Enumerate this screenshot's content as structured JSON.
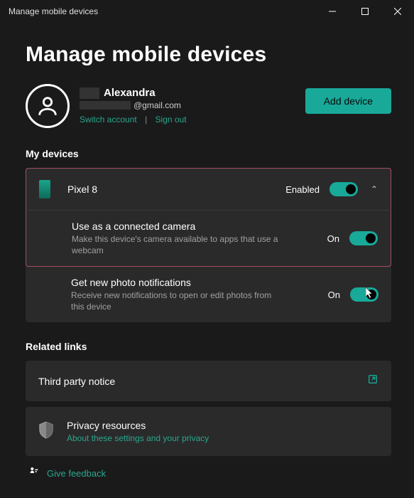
{
  "window": {
    "title": "Manage mobile devices"
  },
  "page": {
    "title": "Manage mobile devices"
  },
  "account": {
    "name": "Alexandra",
    "email_suffix": "@gmail.com",
    "switch_label": "Switch account",
    "signout_label": "Sign out"
  },
  "actions": {
    "add_device": "Add device"
  },
  "sections": {
    "devices_label": "My devices",
    "related_label": "Related links"
  },
  "device": {
    "name": "Pixel 8",
    "status": "Enabled",
    "camera": {
      "title": "Use as a connected camera",
      "desc": "Make this device's camera available to apps that use a webcam",
      "state": "On"
    },
    "photos": {
      "title": "Get new photo notifications",
      "desc": "Receive new notifications to open or edit photos from this device",
      "state": "On"
    }
  },
  "related_links": {
    "third_party": "Third party notice",
    "privacy": {
      "title": "Privacy resources",
      "desc": "About these settings and your privacy"
    }
  },
  "feedback": {
    "label": "Give feedback"
  }
}
